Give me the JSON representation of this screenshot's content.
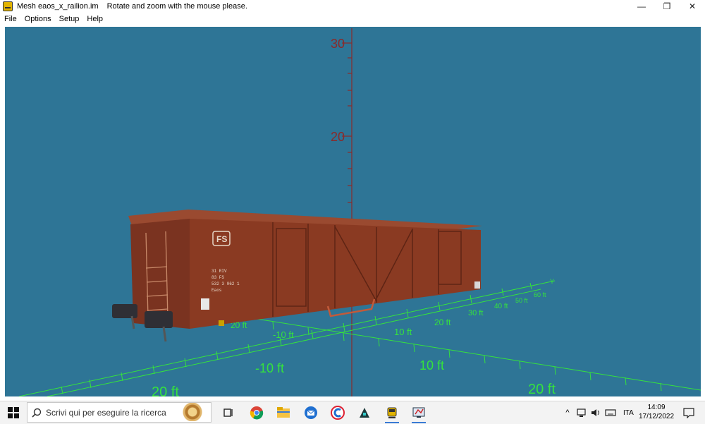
{
  "window": {
    "title": "Mesh eaos_x_railion.im",
    "hint": "Rotate and zoom with the mouse please.",
    "minimize_glyph": "—",
    "restore_glyph": "❐",
    "close_glyph": "✕"
  },
  "menu": [
    {
      "label": "File"
    },
    {
      "label": "Options"
    },
    {
      "label": "Setup"
    },
    {
      "label": "Help"
    }
  ],
  "viewport": {
    "background": "#2e7596",
    "axis_color": "#8a2a2a",
    "grid_color": "#35e23d",
    "vertical_axis_labels": [
      "30",
      "20"
    ],
    "grid_labels": {
      "near_minus_20": "20 ft",
      "near_minus_10": "-10 ft",
      "near_10": "10 ft",
      "near_20": "20 ft",
      "far_minus_20": "20 ft",
      "far_minus_10": "-10 ft",
      "far_10": "10 ft",
      "far_20": "20 ft",
      "far_30": "30 ft",
      "far_40": "40 ft",
      "far_50": "50 ft",
      "far_60": "60 ft",
      "far_y": "Y"
    },
    "wagon": {
      "logo": "FS",
      "body_color": "#8a3a22",
      "marking_lines": [
        "31 RIV",
        "83 FS",
        "532 3 062 1",
        "Eaos"
      ]
    }
  },
  "taskbar": {
    "search_placeholder": "Scrivi qui per eseguire la ricerca",
    "language": "ITA",
    "time": "14:09",
    "date": "17/12/2022",
    "apps": [
      "task-view",
      "chrome",
      "file-explorer",
      "thunderbird",
      "ccleaner",
      "app-dark",
      "train-app",
      "mesh-viewer"
    ]
  }
}
